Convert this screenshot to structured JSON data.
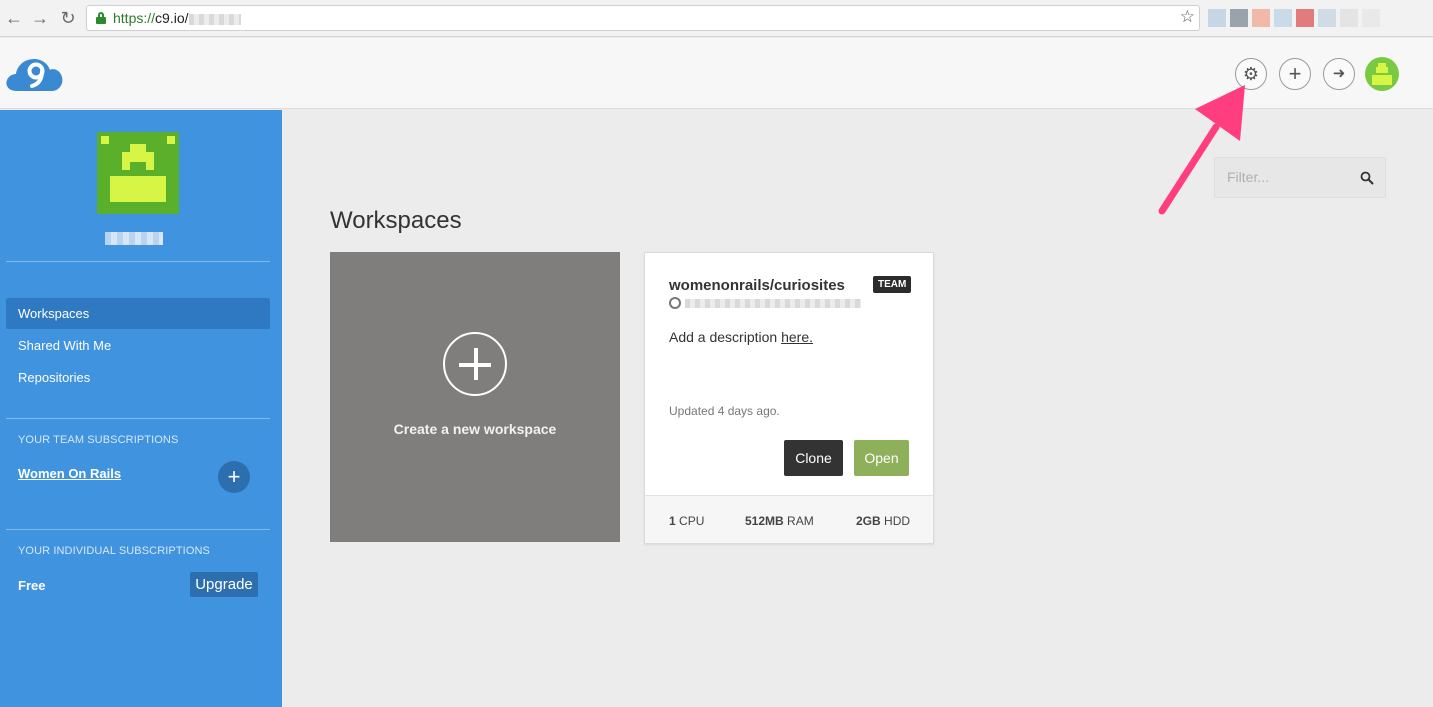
{
  "browser": {
    "back_glyph": "←",
    "forward_glyph": "→",
    "reload_glyph": "↻",
    "url_scheme": "https://",
    "url_host": "c9.io/",
    "bookmark_glyph": "☆"
  },
  "header": {
    "settings_glyph": "⚙",
    "new_glyph": "+",
    "logout_glyph": "➜"
  },
  "sidebar": {
    "nav": [
      {
        "label": "Workspaces",
        "active": true
      },
      {
        "label": "Shared With Me",
        "active": false
      },
      {
        "label": "Repositories",
        "active": false
      }
    ],
    "team_section_title": "YOUR TEAM SUBSCRIPTIONS",
    "team_name": "Women On Rails",
    "team_add_glyph": "+",
    "individual_section_title": "YOUR INDIVIDUAL SUBSCRIPTIONS",
    "plan_name": "Free",
    "upgrade_label": "Upgrade"
  },
  "main": {
    "filter_placeholder": "Filter...",
    "title": "Workspaces",
    "new_workspace_label": "Create a new workspace",
    "workspace": {
      "name": "womenonrails/curiosites",
      "badge": "TEAM",
      "description_prefix": "Add a description ",
      "description_link": "here.",
      "updated": "Updated 4 days ago.",
      "clone_label": "Clone",
      "open_label": "Open",
      "specs": [
        {
          "value": "1",
          "unit": "CPU"
        },
        {
          "value": "512MB",
          "unit": "RAM"
        },
        {
          "value": "2GB",
          "unit": "HDD"
        }
      ]
    }
  },
  "colors": {
    "sidebar": "#3f93df",
    "sidebar_active": "#2e79c1",
    "open_button": "#8fb05b",
    "annotation_arrow": "#ff3d7f"
  }
}
